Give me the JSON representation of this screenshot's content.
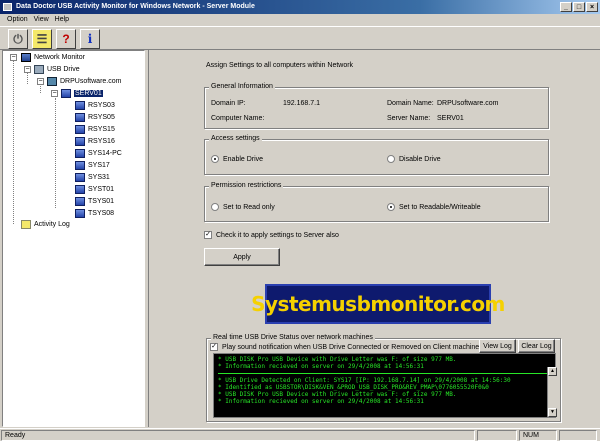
{
  "window": {
    "title": "Data Doctor USB Activity Monitor for Windows Network - Server Module",
    "minimize": "_",
    "maximize": "□",
    "close": "×"
  },
  "menu": [
    "Option",
    "View",
    "Help"
  ],
  "toolbar": {
    "buttons": [
      {
        "name": "plug-icon",
        "glyph": "⏻"
      },
      {
        "name": "notes-icon",
        "glyph": "☰"
      },
      {
        "name": "help-icon",
        "glyph": "?"
      },
      {
        "name": "info-icon",
        "glyph": "i"
      }
    ]
  },
  "tree": {
    "root": "Network Monitor",
    "usb_drive": "USB Drive",
    "domain": "DRPUsoftware.com",
    "server": "SERV01",
    "machines": [
      "RSYS03",
      "RSYS05",
      "RSYS15",
      "RSYS16",
      "SYS14-PC",
      "SYS17",
      "SYS31",
      "SYST01",
      "TSYS01",
      "TSYS08"
    ],
    "activity_log": "Activity Log",
    "expander_minus": "−"
  },
  "settings": {
    "heading": "Assign Settings to all computers within Network",
    "general": {
      "title": "General Information",
      "domain_ip_label": "Domain IP:",
      "domain_ip": "192.168.7.1",
      "domain_name_label": "Domain Name:",
      "domain_name": "DRPUsoftware.com",
      "computer_name_label": "Computer Name:",
      "computer_name": "",
      "server_name_label": "Server Name:",
      "server_name": "SERV01"
    },
    "access": {
      "title": "Access settings",
      "enable": "Enable Drive",
      "disable": "Disable Drive",
      "selected": "enable"
    },
    "permission": {
      "title": "Permission restrictions",
      "read_only": "Set to Read only",
      "read_write": "Set to Readable/Writeable",
      "selected": "read_write"
    },
    "apply_check": "Check it to apply settings to Server also",
    "apply_checked": true,
    "apply_button": "Apply",
    "check_mark": "✓"
  },
  "watermark": "Systemusbmonitor.com",
  "realtime": {
    "title": "Real time USB Drive Status over network machines",
    "sound_check": "Play sound notification when USB Drive Connected or Removed on Client machines",
    "sound_checked": true,
    "view_log": "View Log",
    "clear_log": "Clear Log",
    "log_block1": [
      "* USB DISK Pro USB Device  with Drive Letter was F: of size 977 MB.",
      "* Information recieved on server on 29/4/2008 at 14:56:31"
    ],
    "log_block2": [
      "* USB Drive Detected on Client: SYS17 [IP: 192.168.7.14] on 29/4/2008 at 14:56:30",
      "* Identified as USBSTOR\\DISK&VEN_&PROD_USB_DISK_PRO&REV_PMAP\\0776055520F0&0",
      "* USB DISK Pro USB Device  with Drive Letter was F: of size 977 MB.",
      "* Information recieved on server on 29/4/2008 at 14:56:31"
    ],
    "scroll_up": "▲",
    "scroll_down": "▼"
  },
  "status": {
    "text": "Ready",
    "num": "NUM"
  }
}
